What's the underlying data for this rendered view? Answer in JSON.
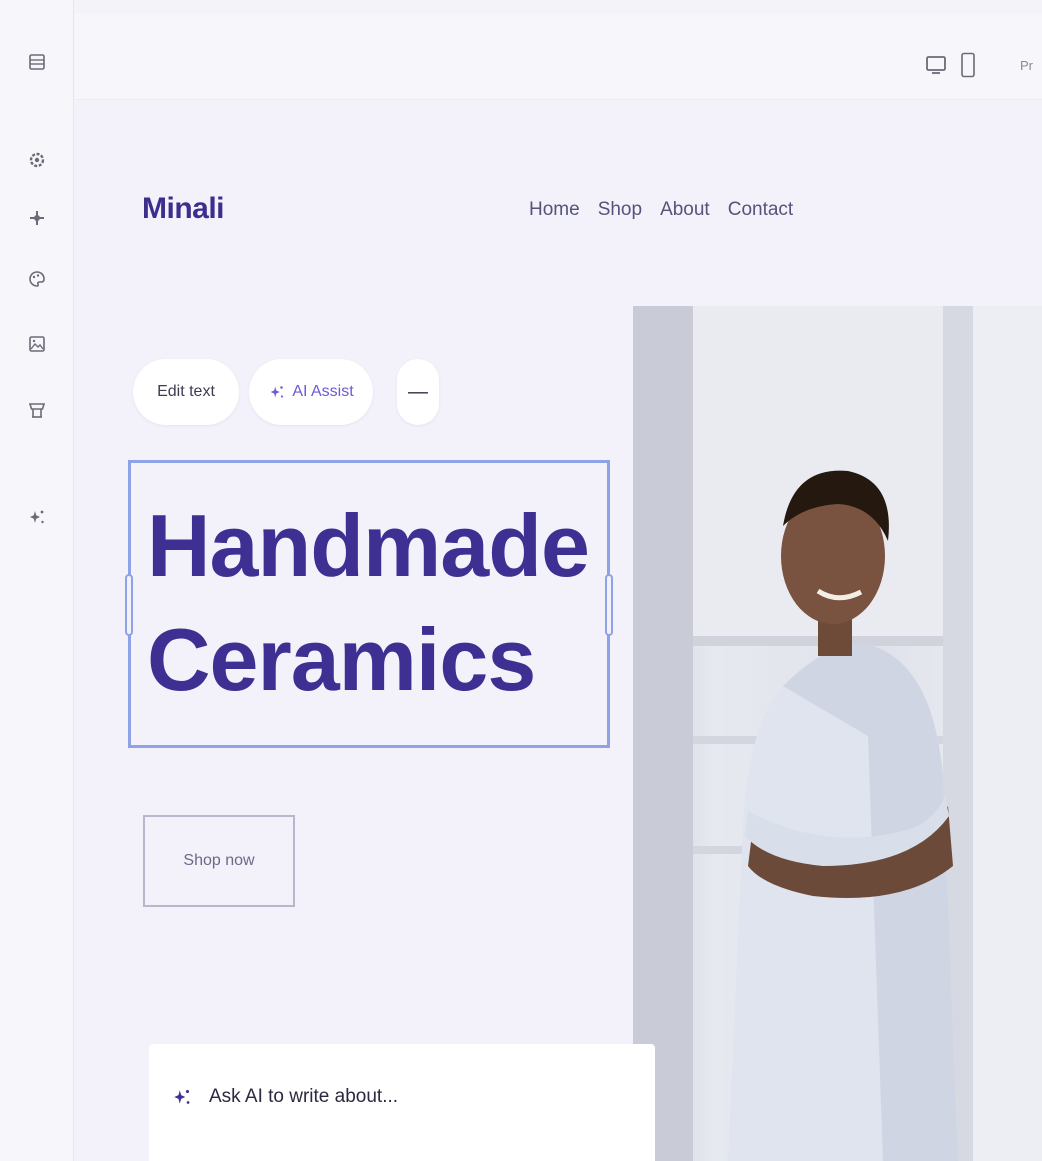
{
  "rail": {
    "items": [
      {
        "icon": "hamburger-menu-icon"
      },
      {
        "icon": "gear-icon"
      },
      {
        "icon": "add-element-icon"
      },
      {
        "icon": "palette-icon"
      },
      {
        "icon": "image-icon"
      },
      {
        "icon": "store-icon"
      },
      {
        "icon": "ai-sparkle-icon"
      }
    ]
  },
  "topbar": {
    "devices": [
      "desktop-icon",
      "mobile-icon"
    ],
    "label": "Pr"
  },
  "site": {
    "brand": "Minali",
    "nav": [
      "Home",
      "Shop",
      "About",
      "Contact"
    ],
    "headline_line1": "Handmade",
    "headline_line2": "Ceramics",
    "cta": "Shop now"
  },
  "toolbar": {
    "edit_text": "Edit text",
    "ai_assist": "AI Assist",
    "more": "—"
  },
  "ask_ai": {
    "placeholder": "Ask AI to write about..."
  },
  "colors": {
    "brand": "#3e2f92",
    "accent": "#6c5bd6",
    "selection": "#8fa2e6",
    "canvas_bg": "#f3f2fb"
  }
}
